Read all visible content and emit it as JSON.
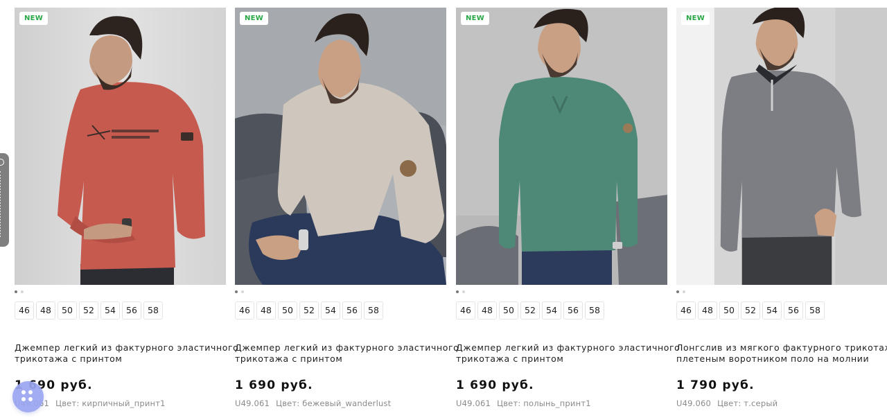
{
  "products": [
    {
      "badge": "NEW",
      "sizes": [
        "46",
        "48",
        "50",
        "52",
        "54",
        "56",
        "58"
      ],
      "title_line1": "Джемпер легкий из фактурного эластичного",
      "title_line2": "трикотажа с принтом",
      "price": "1 690 руб.",
      "sku": "U49.061",
      "color": "Цвет: кирпичный_принт1",
      "garment_color": "#c65a4f",
      "photo_icon": "model-photo-brick-sweater"
    },
    {
      "badge": "NEW",
      "sizes": [
        "46",
        "48",
        "50",
        "52",
        "54",
        "56",
        "58"
      ],
      "title_line1": "Джемпер легкий из фактурного эластичного",
      "title_line2": "трикотажа с принтом",
      "price": "1 690 руб.",
      "sku": "U49.061",
      "color": "Цвет: бежевый_wanderlust",
      "garment_color": "#cfc6bd",
      "photo_icon": "model-photo-beige-sweater"
    },
    {
      "badge": "NEW",
      "sizes": [
        "46",
        "48",
        "50",
        "52",
        "54",
        "56",
        "58"
      ],
      "title_line1": "Джемпер легкий из фактурного эластичного",
      "title_line2": "трикотажа с принтом",
      "price": "1 690 руб.",
      "sku": "U49.061",
      "color": "Цвет: полынь_принт1",
      "garment_color": "#4e8877",
      "photo_icon": "model-photo-green-sweater"
    },
    {
      "badge": "NEW",
      "sizes": [
        "46",
        "48",
        "50",
        "52",
        "54",
        "56",
        "58"
      ],
      "title_line1": "Лонгслив из мягкого фактурного трикотажа с",
      "title_line2": "плетеным воротником поло на молнии",
      "price": "1 790 руб.",
      "sku": "U49.060",
      "color": "Цвет: т.серый",
      "garment_color": "#7c7e83",
      "photo_icon": "model-photo-grey-polo"
    }
  ],
  "widgets": {
    "side_tab_icon": "chat-icon",
    "float_button_icon": "dots-menu-icon",
    "float_button_color": "#9aa6f1"
  }
}
